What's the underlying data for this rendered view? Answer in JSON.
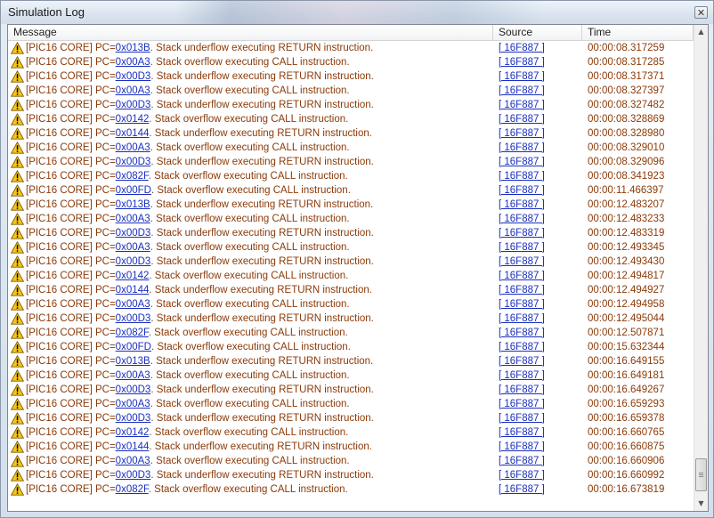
{
  "window": {
    "title": "Simulation Log",
    "close_glyph": "✕"
  },
  "table": {
    "columns": [
      "Message",
      "Source",
      "Time"
    ],
    "rows": [
      {
        "prefix": "[PIC16 CORE] PC=",
        "pc": "0x013B",
        "text": ". Stack underflow executing RETURN instruction.",
        "source": "[ 16F887 ]",
        "time": "00:00:08.317259"
      },
      {
        "prefix": "[PIC16 CORE] PC=",
        "pc": "0x00A3",
        "text": ". Stack overflow executing CALL instruction.",
        "source": "[ 16F887 ]",
        "time": "00:00:08.317285"
      },
      {
        "prefix": "[PIC16 CORE] PC=",
        "pc": "0x00D3",
        "text": ". Stack underflow executing RETURN instruction.",
        "source": "[ 16F887 ]",
        "time": "00:00:08.317371"
      },
      {
        "prefix": "[PIC16 CORE] PC=",
        "pc": "0x00A3",
        "text": ". Stack overflow executing CALL instruction.",
        "source": "[ 16F887 ]",
        "time": "00:00:08.327397"
      },
      {
        "prefix": "[PIC16 CORE] PC=",
        "pc": "0x00D3",
        "text": ". Stack underflow executing RETURN instruction.",
        "source": "[ 16F887 ]",
        "time": "00:00:08.327482"
      },
      {
        "prefix": "[PIC16 CORE] PC=",
        "pc": "0x0142",
        "text": ". Stack overflow executing CALL instruction.",
        "source": "[ 16F887 ]",
        "time": "00:00:08.328869"
      },
      {
        "prefix": "[PIC16 CORE] PC=",
        "pc": "0x0144",
        "text": ". Stack underflow executing RETURN instruction.",
        "source": "[ 16F887 ]",
        "time": "00:00:08.328980"
      },
      {
        "prefix": "[PIC16 CORE] PC=",
        "pc": "0x00A3",
        "text": ". Stack overflow executing CALL instruction.",
        "source": "[ 16F887 ]",
        "time": "00:00:08.329010"
      },
      {
        "prefix": "[PIC16 CORE] PC=",
        "pc": "0x00D3",
        "text": ". Stack underflow executing RETURN instruction.",
        "source": "[ 16F887 ]",
        "time": "00:00:08.329096"
      },
      {
        "prefix": "[PIC16 CORE] PC=",
        "pc": "0x082F",
        "text": ". Stack overflow executing CALL instruction.",
        "source": "[ 16F887 ]",
        "time": "00:00:08.341923"
      },
      {
        "prefix": "[PIC16 CORE] PC=",
        "pc": "0x00FD",
        "text": ". Stack overflow executing CALL instruction.",
        "source": "[ 16F887 ]",
        "time": "00:00:11.466397"
      },
      {
        "prefix": "[PIC16 CORE] PC=",
        "pc": "0x013B",
        "text": ". Stack underflow executing RETURN instruction.",
        "source": "[ 16F887 ]",
        "time": "00:00:12.483207"
      },
      {
        "prefix": "[PIC16 CORE] PC=",
        "pc": "0x00A3",
        "text": ". Stack overflow executing CALL instruction.",
        "source": "[ 16F887 ]",
        "time": "00:00:12.483233"
      },
      {
        "prefix": "[PIC16 CORE] PC=",
        "pc": "0x00D3",
        "text": ". Stack underflow executing RETURN instruction.",
        "source": "[ 16F887 ]",
        "time": "00:00:12.483319"
      },
      {
        "prefix": "[PIC16 CORE] PC=",
        "pc": "0x00A3",
        "text": ". Stack overflow executing CALL instruction.",
        "source": "[ 16F887 ]",
        "time": "00:00:12.493345"
      },
      {
        "prefix": "[PIC16 CORE] PC=",
        "pc": "0x00D3",
        "text": ". Stack underflow executing RETURN instruction.",
        "source": "[ 16F887 ]",
        "time": "00:00:12.493430"
      },
      {
        "prefix": "[PIC16 CORE] PC=",
        "pc": "0x0142",
        "text": ". Stack overflow executing CALL instruction.",
        "source": "[ 16F887 ]",
        "time": "00:00:12.494817"
      },
      {
        "prefix": "[PIC16 CORE] PC=",
        "pc": "0x0144",
        "text": ". Stack underflow executing RETURN instruction.",
        "source": "[ 16F887 ]",
        "time": "00:00:12.494927"
      },
      {
        "prefix": "[PIC16 CORE] PC=",
        "pc": "0x00A3",
        "text": ". Stack overflow executing CALL instruction.",
        "source": "[ 16F887 ]",
        "time": "00:00:12.494958"
      },
      {
        "prefix": "[PIC16 CORE] PC=",
        "pc": "0x00D3",
        "text": ". Stack underflow executing RETURN instruction.",
        "source": "[ 16F887 ]",
        "time": "00:00:12.495044"
      },
      {
        "prefix": "[PIC16 CORE] PC=",
        "pc": "0x082F",
        "text": ". Stack overflow executing CALL instruction.",
        "source": "[ 16F887 ]",
        "time": "00:00:12.507871"
      },
      {
        "prefix": "[PIC16 CORE] PC=",
        "pc": "0x00FD",
        "text": ". Stack overflow executing CALL instruction.",
        "source": "[ 16F887 ]",
        "time": "00:00:15.632344"
      },
      {
        "prefix": "[PIC16 CORE] PC=",
        "pc": "0x013B",
        "text": ". Stack underflow executing RETURN instruction.",
        "source": "[ 16F887 ]",
        "time": "00:00:16.649155"
      },
      {
        "prefix": "[PIC16 CORE] PC=",
        "pc": "0x00A3",
        "text": ". Stack overflow executing CALL instruction.",
        "source": "[ 16F887 ]",
        "time": "00:00:16.649181"
      },
      {
        "prefix": "[PIC16 CORE] PC=",
        "pc": "0x00D3",
        "text": ". Stack underflow executing RETURN instruction.",
        "source": "[ 16F887 ]",
        "time": "00:00:16.649267"
      },
      {
        "prefix": "[PIC16 CORE] PC=",
        "pc": "0x00A3",
        "text": ". Stack overflow executing CALL instruction.",
        "source": "[ 16F887 ]",
        "time": "00:00:16.659293"
      },
      {
        "prefix": "[PIC16 CORE] PC=",
        "pc": "0x00D3",
        "text": ". Stack underflow executing RETURN instruction.",
        "source": "[ 16F887 ]",
        "time": "00:00:16.659378"
      },
      {
        "prefix": "[PIC16 CORE] PC=",
        "pc": "0x0142",
        "text": ". Stack overflow executing CALL instruction.",
        "source": "[ 16F887 ]",
        "time": "00:00:16.660765"
      },
      {
        "prefix": "[PIC16 CORE] PC=",
        "pc": "0x0144",
        "text": ". Stack underflow executing RETURN instruction.",
        "source": "[ 16F887 ]",
        "time": "00:00:16.660875"
      },
      {
        "prefix": "[PIC16 CORE] PC=",
        "pc": "0x00A3",
        "text": ". Stack overflow executing CALL instruction.",
        "source": "[ 16F887 ]",
        "time": "00:00:16.660906"
      },
      {
        "prefix": "[PIC16 CORE] PC=",
        "pc": "0x00D3",
        "text": ". Stack underflow executing RETURN instruction.",
        "source": "[ 16F887 ]",
        "time": "00:00:16.660992"
      },
      {
        "prefix": "[PIC16 CORE] PC=",
        "pc": "0x082F",
        "text": ". Stack overflow executing CALL instruction.",
        "source": "[ 16F887 ]",
        "time": "00:00:16.673819"
      }
    ]
  },
  "icons": {
    "row_icon": "warning-icon"
  },
  "scrollbar": {
    "up_glyph": "▲",
    "down_glyph": "▼",
    "position": 0.97
  },
  "colors": {
    "message_text": "#8b3a08",
    "link": "#1a2fbf",
    "warning_fill": "#f5c518"
  }
}
